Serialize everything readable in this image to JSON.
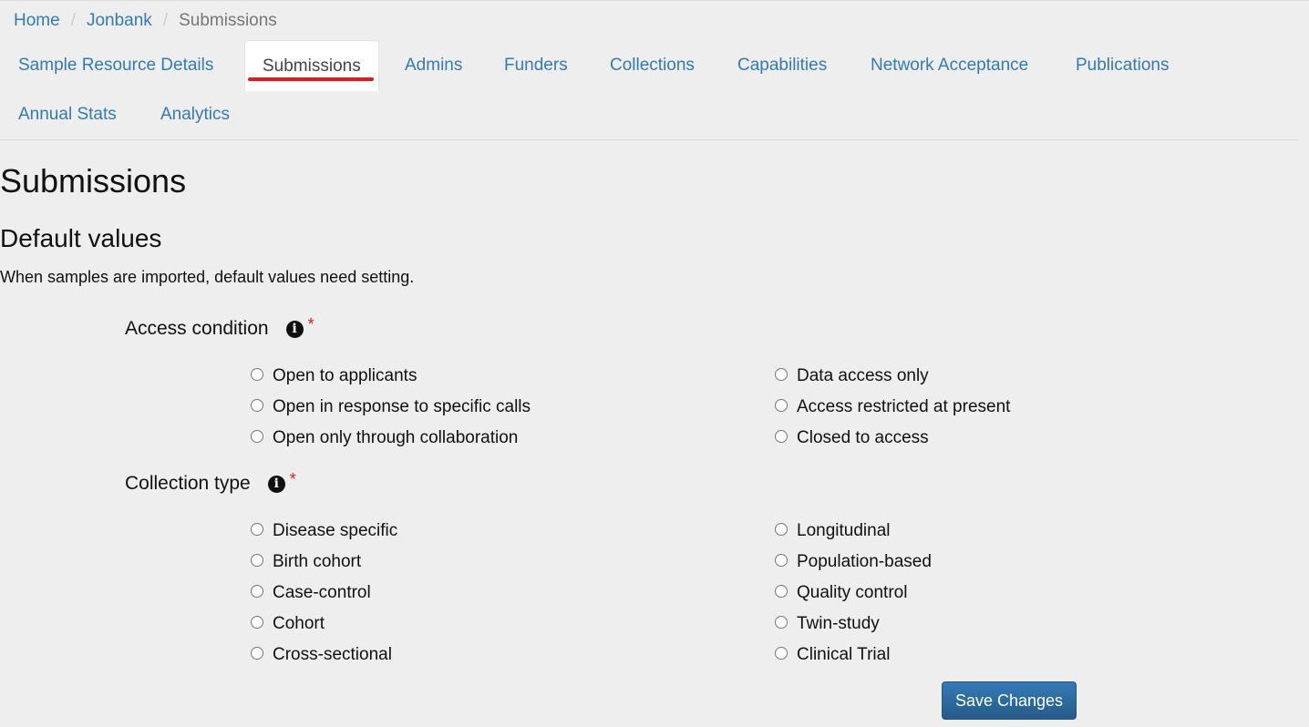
{
  "breadcrumb": {
    "items": [
      {
        "label": "Home"
      },
      {
        "label": "Jonbank"
      },
      {
        "label": "Submissions"
      }
    ],
    "separator": "/"
  },
  "tabs": [
    {
      "label": "Sample Resource Details",
      "active": false
    },
    {
      "label": "Submissions",
      "active": true
    },
    {
      "label": "Admins",
      "active": false
    },
    {
      "label": "Funders",
      "active": false
    },
    {
      "label": "Collections",
      "active": false
    },
    {
      "label": "Capabilities",
      "active": false
    },
    {
      "label": "Network Acceptance",
      "active": false
    },
    {
      "label": "Publications",
      "active": false
    },
    {
      "label": "Annual Stats",
      "active": false
    },
    {
      "label": "Analytics",
      "active": false
    }
  ],
  "page": {
    "title": "Submissions",
    "section_title": "Default values",
    "section_desc": "When samples are imported, default values need setting."
  },
  "fields": {
    "access_condition": {
      "label": "Access condition",
      "info_icon": "info-circle-icon",
      "required_marker": "*",
      "options_left": [
        {
          "label": "Open to applicants",
          "checked": false
        },
        {
          "label": "Open in response to specific calls",
          "checked": false
        },
        {
          "label": "Open only through collaboration",
          "checked": false
        }
      ],
      "options_right": [
        {
          "label": "Data access only",
          "checked": false
        },
        {
          "label": "Access restricted at present",
          "checked": false
        },
        {
          "label": "Closed to access",
          "checked": false
        }
      ]
    },
    "collection_type": {
      "label": "Collection type",
      "info_icon": "info-circle-icon",
      "required_marker": "*",
      "options_left": [
        {
          "label": "Disease specific",
          "checked": false
        },
        {
          "label": "Birth cohort",
          "checked": false
        },
        {
          "label": "Case-control",
          "checked": false
        },
        {
          "label": "Cohort",
          "checked": false
        },
        {
          "label": "Cross-sectional",
          "checked": false
        }
      ],
      "options_right": [
        {
          "label": "Longitudinal",
          "checked": false
        },
        {
          "label": "Population-based",
          "checked": false
        },
        {
          "label": "Quality control",
          "checked": false
        },
        {
          "label": "Twin-study",
          "checked": false
        },
        {
          "label": "Clinical Trial",
          "checked": false
        }
      ]
    }
  },
  "actions": {
    "save_label": "Save Changes"
  },
  "colors": {
    "link": "#337ab7",
    "required": "#e01b1b",
    "active_tab_underline": "#e01b1b",
    "primary_button": "#2e6da4",
    "background": "#eeeeee"
  }
}
